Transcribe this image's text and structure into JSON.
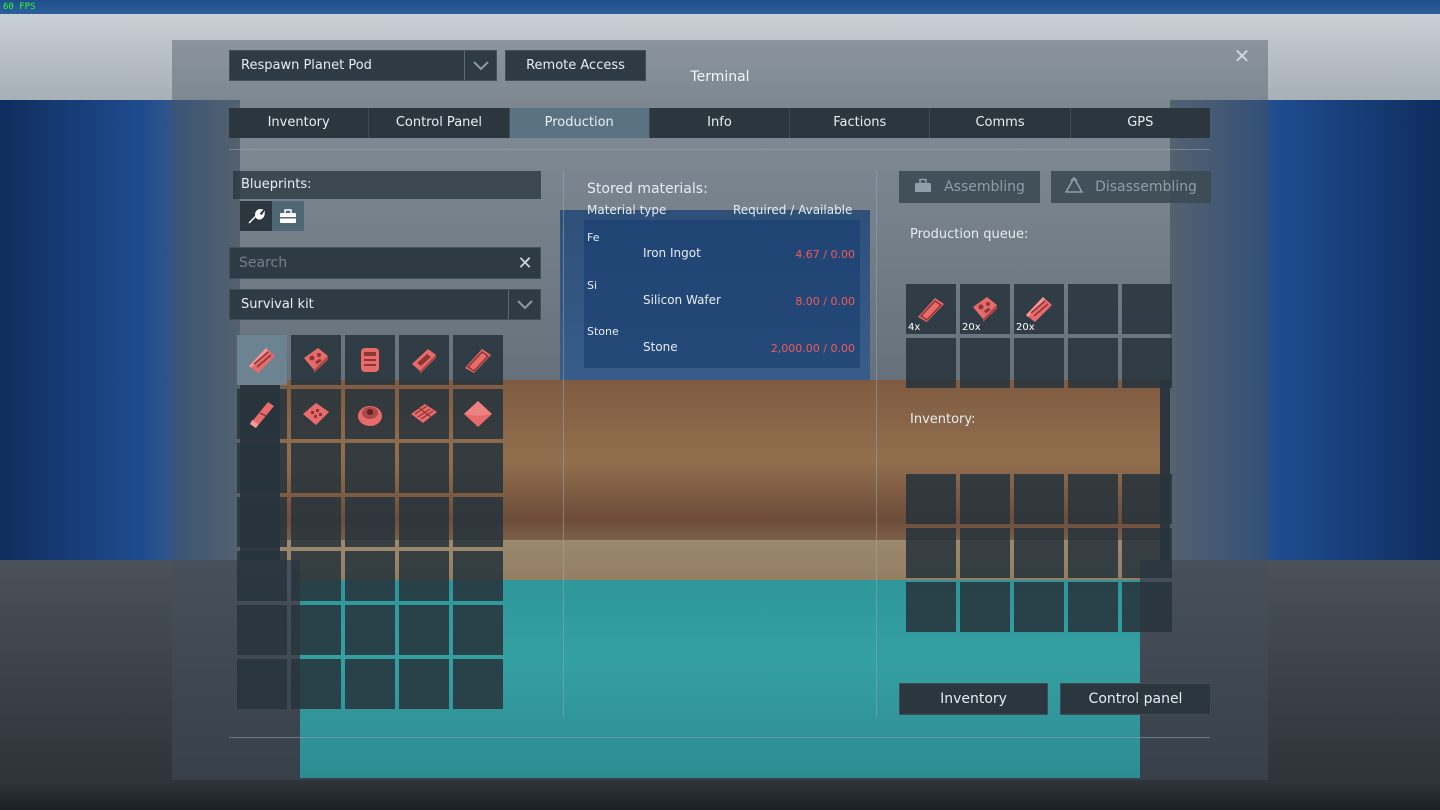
{
  "fps": "60 FPS",
  "window": {
    "title": "Terminal",
    "close_icon": "close-icon"
  },
  "header": {
    "grid_selector": "Respawn Planet Pod",
    "remote_access": "Remote Access"
  },
  "tabs": [
    {
      "label": "Inventory",
      "active": false
    },
    {
      "label": "Control Panel",
      "active": false
    },
    {
      "label": "Production",
      "active": true
    },
    {
      "label": "Info",
      "active": false
    },
    {
      "label": "Factions",
      "active": false
    },
    {
      "label": "Comms",
      "active": false
    },
    {
      "label": "GPS",
      "active": false
    }
  ],
  "blueprints": {
    "title": "Blueprints:",
    "filters": [
      "wrench-filter-icon",
      "toolbox-filter-icon"
    ],
    "search_placeholder": "Search",
    "category": "Survival kit",
    "items": [
      {
        "icon": "steel-plate-icon",
        "selected": true
      },
      {
        "icon": "construction-component-icon"
      },
      {
        "icon": "interior-plate-icon"
      },
      {
        "icon": "computer-icon"
      },
      {
        "icon": "metal-plate-icon"
      },
      {
        "icon": "metal-grid-icon"
      },
      {
        "icon": "motor-icon"
      },
      {
        "icon": "reactor-component-icon"
      },
      {
        "icon": "girder-icon"
      },
      {
        "icon": "small-plate-icon"
      }
    ],
    "total_slots": 35
  },
  "stored_materials": {
    "title": "Stored materials:",
    "col_type": "Material type",
    "col_amount": "Required / Available",
    "rows": [
      {
        "type": "Fe",
        "name": "Iron Ingot",
        "amount": "4.67 / 0.00"
      },
      {
        "type": "Si",
        "name": "Silicon Wafer",
        "amount": "8.00 / 0.00"
      },
      {
        "type": "Stone",
        "name": "Stone",
        "amount": "2,000.00 / 0.00"
      }
    ]
  },
  "modes": {
    "assembling": "Assembling",
    "disassembling": "Disassembling"
  },
  "production_queue": {
    "title": "Production queue:",
    "items": [
      {
        "icon": "metal-plate-icon",
        "qty": "4x"
      },
      {
        "icon": "construction-component-icon",
        "qty": "20x"
      },
      {
        "icon": "steel-plate-icon",
        "qty": "20x"
      }
    ],
    "total_slots": 10
  },
  "inventory": {
    "title": "Inventory:",
    "total_slots": 15
  },
  "footer": {
    "inventory_button": "Inventory",
    "control_panel_button": "Control panel"
  },
  "colors": {
    "accent": "#5a7282",
    "missing_material": "#f25a5a",
    "item_tint": "#e86b6b"
  }
}
